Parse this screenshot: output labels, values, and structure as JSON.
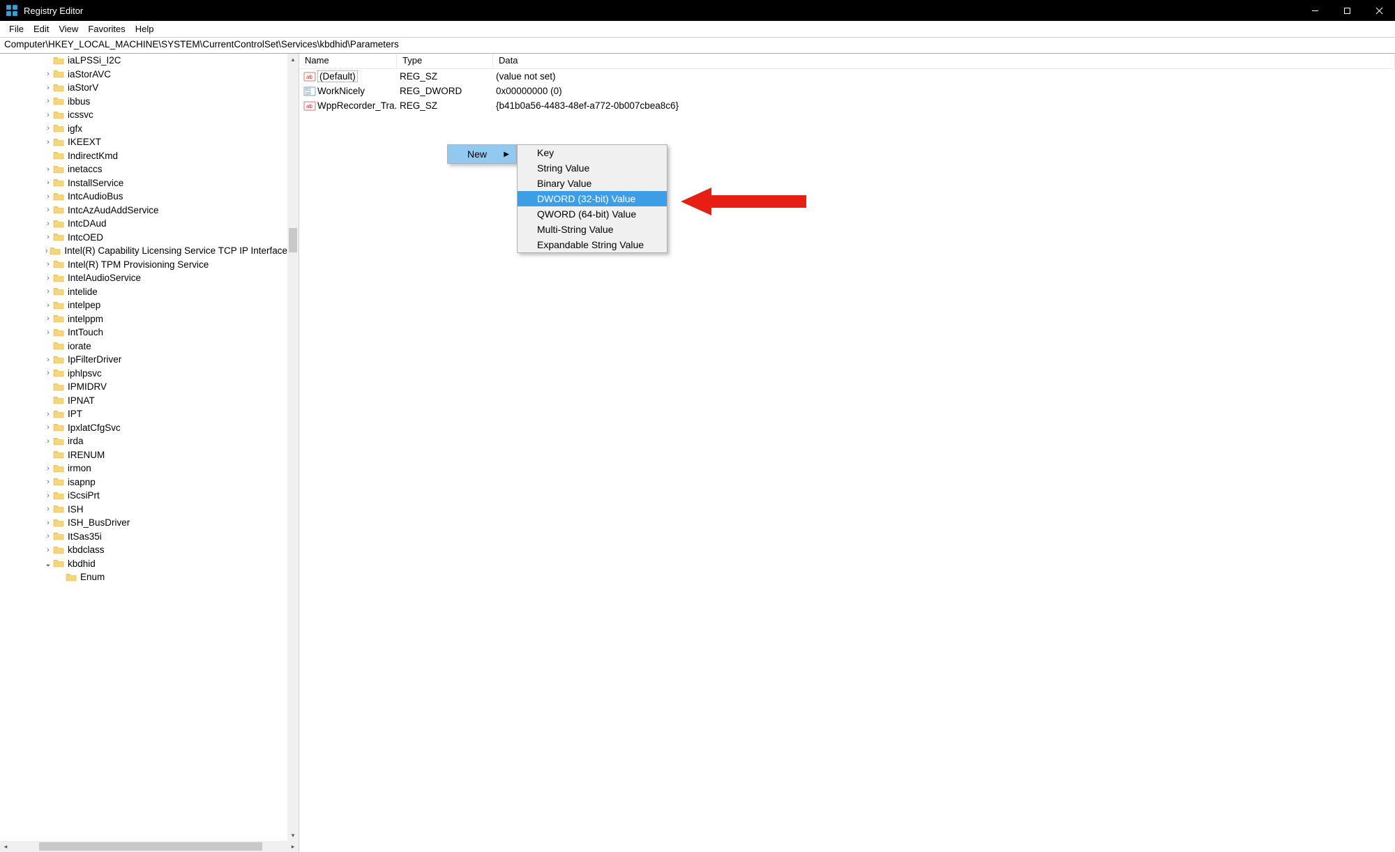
{
  "window": {
    "title": "Registry Editor"
  },
  "titlebar_buttons": {
    "minimize": "–",
    "maximize": "▢",
    "close": "✕"
  },
  "menubar": [
    "File",
    "Edit",
    "View",
    "Favorites",
    "Help"
  ],
  "address": "Computer\\HKEY_LOCAL_MACHINE\\SYSTEM\\CurrentControlSet\\Services\\kbdhid\\Parameters",
  "tree": [
    {
      "indent": 3,
      "expander": "",
      "label": "iaLPSSi_I2C"
    },
    {
      "indent": 3,
      "expander": ">",
      "label": "iaStorAVC"
    },
    {
      "indent": 3,
      "expander": ">",
      "label": "iaStorV"
    },
    {
      "indent": 3,
      "expander": ">",
      "label": "ibbus"
    },
    {
      "indent": 3,
      "expander": ">",
      "label": "icssvc"
    },
    {
      "indent": 3,
      "expander": ">",
      "label": "igfx"
    },
    {
      "indent": 3,
      "expander": ">",
      "label": "IKEEXT"
    },
    {
      "indent": 3,
      "expander": "",
      "label": "IndirectKmd"
    },
    {
      "indent": 3,
      "expander": ">",
      "label": "inetaccs"
    },
    {
      "indent": 3,
      "expander": ">",
      "label": "InstallService"
    },
    {
      "indent": 3,
      "expander": ">",
      "label": "IntcAudioBus"
    },
    {
      "indent": 3,
      "expander": ">",
      "label": "IntcAzAudAddService"
    },
    {
      "indent": 3,
      "expander": ">",
      "label": "IntcDAud"
    },
    {
      "indent": 3,
      "expander": ">",
      "label": "IntcOED"
    },
    {
      "indent": 3,
      "expander": ">",
      "label": "Intel(R) Capability Licensing Service TCP IP Interface"
    },
    {
      "indent": 3,
      "expander": ">",
      "label": "Intel(R) TPM Provisioning Service"
    },
    {
      "indent": 3,
      "expander": ">",
      "label": "IntelAudioService"
    },
    {
      "indent": 3,
      "expander": ">",
      "label": "intelide"
    },
    {
      "indent": 3,
      "expander": ">",
      "label": "intelpep"
    },
    {
      "indent": 3,
      "expander": ">",
      "label": "intelppm"
    },
    {
      "indent": 3,
      "expander": ">",
      "label": "IntTouch"
    },
    {
      "indent": 3,
      "expander": "",
      "label": "iorate"
    },
    {
      "indent": 3,
      "expander": ">",
      "label": "IpFilterDriver"
    },
    {
      "indent": 3,
      "expander": ">",
      "label": "iphlpsvc"
    },
    {
      "indent": 3,
      "expander": "",
      "label": "IPMIDRV"
    },
    {
      "indent": 3,
      "expander": "",
      "label": "IPNAT"
    },
    {
      "indent": 3,
      "expander": ">",
      "label": "IPT"
    },
    {
      "indent": 3,
      "expander": ">",
      "label": "IpxlatCfgSvc"
    },
    {
      "indent": 3,
      "expander": ">",
      "label": "irda"
    },
    {
      "indent": 3,
      "expander": "",
      "label": "IRENUM"
    },
    {
      "indent": 3,
      "expander": ">",
      "label": "irmon"
    },
    {
      "indent": 3,
      "expander": ">",
      "label": "isapnp"
    },
    {
      "indent": 3,
      "expander": ">",
      "label": "iScsiPrt"
    },
    {
      "indent": 3,
      "expander": ">",
      "label": "ISH"
    },
    {
      "indent": 3,
      "expander": ">",
      "label": "ISH_BusDriver"
    },
    {
      "indent": 3,
      "expander": ">",
      "label": "ItSas35i"
    },
    {
      "indent": 3,
      "expander": ">",
      "label": "kbdclass"
    },
    {
      "indent": 3,
      "expander": "v",
      "label": "kbdhid"
    },
    {
      "indent": 4,
      "expander": "",
      "label": "Enum"
    }
  ],
  "list": {
    "columns": {
      "name": "Name",
      "type": "Type",
      "data": "Data"
    },
    "rows": [
      {
        "iconKind": "sz",
        "name": "(Default)",
        "isDefault": true,
        "type": "REG_SZ",
        "data": "(value not set)"
      },
      {
        "iconKind": "dw",
        "name": "WorkNicely",
        "isDefault": false,
        "type": "REG_DWORD",
        "data": "0x00000000 (0)"
      },
      {
        "iconKind": "sz",
        "name": "WppRecorder_Tra...",
        "isDefault": false,
        "type": "REG_SZ",
        "data": "{b41b0a56-4483-48ef-a772-0b007cbea8c6}"
      }
    ]
  },
  "context_menu": {
    "root": {
      "label": "New",
      "arrow": "▶"
    },
    "submenu": [
      "Key",
      "String Value",
      "Binary Value",
      "DWORD (32-bit) Value",
      "QWORD (64-bit) Value",
      "Multi-String Value",
      "Expandable String Value"
    ],
    "highlight_index": 3
  },
  "colors": {
    "accent": "#3d9ee6",
    "context_sel": "#91c9f0",
    "red_arrow": "#e61e14"
  }
}
